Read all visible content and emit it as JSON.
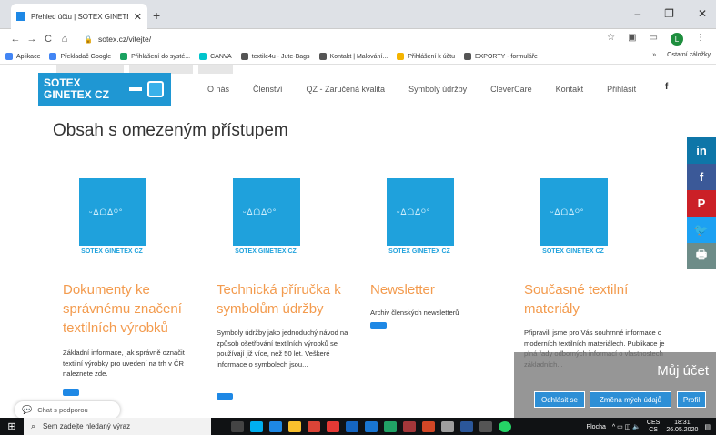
{
  "browser": {
    "tab_title": "Přehled účtu | SOTEX GINETEX Č",
    "tab_close": "✕",
    "new_tab": "+",
    "win_min": "–",
    "win_max": "❐",
    "win_close": "✕",
    "nav_back": "←",
    "nav_forward": "→",
    "nav_reload": "C",
    "nav_home": "⌂",
    "url": "sotex.cz/vitejte/",
    "star": "☆",
    "menu_dots": "⋮",
    "avatar_letter": "L"
  },
  "bookmarks": [
    {
      "label": "Aplikace",
      "color": "#4285f4"
    },
    {
      "label": "Překladač Google",
      "color": "#4285f4"
    },
    {
      "label": "Přihlášení do systé...",
      "color": "#1aa260"
    },
    {
      "label": "CANVA",
      "color": "#00c4cc"
    },
    {
      "label": "textile4u - Jute-Bags",
      "color": "#555555"
    },
    {
      "label": "Kontakt | Malování...",
      "color": "#555555"
    },
    {
      "label": "Přihlášení k účtu",
      "color": "#f4b400"
    },
    {
      "label": "EXPORTY - formuláře",
      "color": "#555555"
    }
  ],
  "bookmarks_more": "»",
  "bookmarks_other": "Ostatní záložky",
  "site": {
    "logo_line1": "SOTEX",
    "logo_line2": "GINETEX CZ",
    "menu": [
      "O nás",
      "Členství",
      "QZ - Zaručená kvalita",
      "Symboly údržby",
      "CleverCare",
      "Kontakt",
      "Přihlásit"
    ],
    "fb_label": "f",
    "page_title": "Obsah s omezeným přístupem",
    "tile_glyph": "ᵕᐃᗝᐃᴼ°",
    "cards": [
      {
        "caption": "SOTEX GINETEX CZ",
        "title": "Dokumenty ke správnému značení textilních výrobků",
        "body": "Základní informace, jak správně označit textilní výrobky pro uvedení na trh v ČR naleznete zde."
      },
      {
        "caption": "SOTEX GINETEX CZ",
        "title": "Technická příručka k symbolům údržby",
        "body": "Symboly údržby jako jednoduchý návod na způsob ošetřování textilních výrobků se používají již více, než 50 let. Veškeré informace o symbolech jsou..."
      },
      {
        "caption": "SOTEX GINETEX CZ",
        "title": "Newsletter",
        "body": "Archiv členských newsletterů"
      },
      {
        "caption": "SOTEX GINETEX CZ",
        "title": "Současné textilní materiály",
        "body": "Připravili jsme pro Vás souhrnné informace o moderních textilních materiálech. Publikace je plná řady odborných informací o vlastnostech základních..."
      }
    ],
    "social": [
      {
        "label": "in",
        "color": "#0e76a8"
      },
      {
        "label": "f",
        "color": "#3b5998"
      },
      {
        "label": "P",
        "color": "#cb2027"
      },
      {
        "label": "🐦",
        "color": "#1da1f2"
      },
      {
        "label": "🖶",
        "color": "#6d8c88"
      }
    ],
    "account_label": "Můj účet",
    "account_buttons": [
      "Odhlásit se",
      "Změna mých údajů",
      "Profil"
    ],
    "chat_label": "Chat s podporou"
  },
  "taskbar": {
    "search_placeholder": "Sem zadejte hledaný výraz",
    "tray_label": "Plocha",
    "lang": "CES",
    "lang2": "CS",
    "time": "18:31",
    "date": "26.05.2020"
  }
}
